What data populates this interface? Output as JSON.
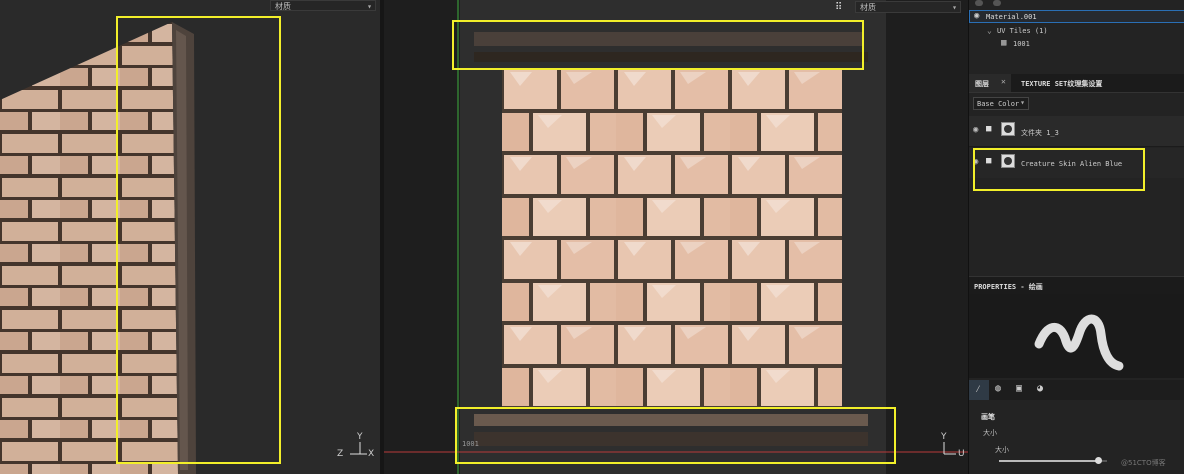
{
  "viewport3d": {
    "material_dropdown": "材质",
    "axis_y": "Y",
    "axis_z": "Z",
    "axis_x": "X"
  },
  "viewport2d": {
    "material_dropdown": "材质",
    "uv_tile_label": "1001",
    "axis_y": "Y",
    "axis_u": "U"
  },
  "panel": {
    "tree": {
      "material": "Material.001",
      "uv_tiles": "UV Tiles (1)",
      "tile": "1001"
    },
    "tabs": {
      "layers": "图层",
      "texture_set": "TEXTURE SET纹理集设置"
    },
    "channel_select": "Base Color",
    "layers": [
      {
        "name": "文件夹 1_3"
      },
      {
        "name": "Creature Skin Alien Blue"
      }
    ],
    "properties_title": "PROPERTIES - 绘画",
    "brush_section": "画笔",
    "size_label": "大小",
    "size_sub_label": "大小",
    "size_value": 0.92
  },
  "watermark": "@51CTO博客",
  "colors": {
    "highlight": "#f2ef2a",
    "brick": "#e8c6b0",
    "mortar": "#4a3d33",
    "selection_blue": "#2a6fb5"
  }
}
